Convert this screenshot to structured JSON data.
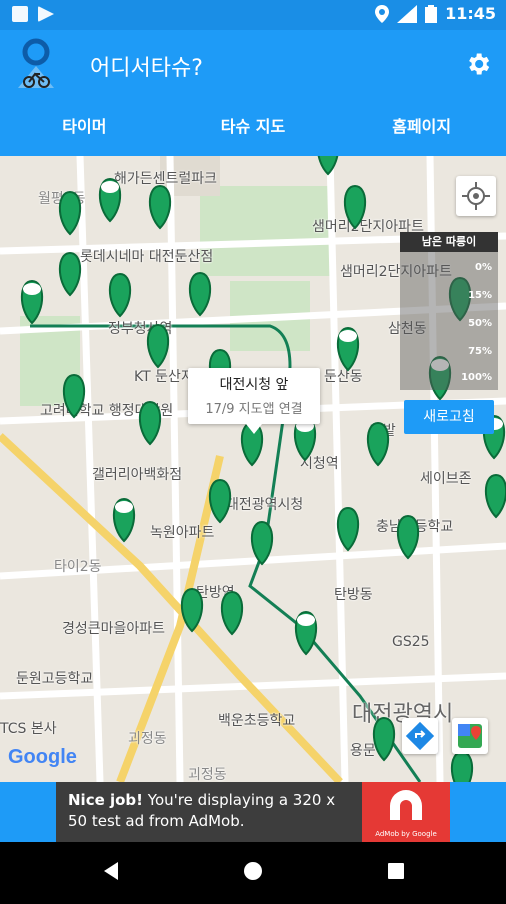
{
  "status_bar": {
    "time": "11:45",
    "network": "LTE"
  },
  "app_bar": {
    "title": "어디서타슈?"
  },
  "tabs": [
    {
      "label": "타이머"
    },
    {
      "label": "타슈 지도"
    },
    {
      "label": "홈페이지"
    }
  ],
  "map": {
    "labels": [
      "해가든센트럴파크",
      "월평2동",
      "롯데시네마 대전둔산점",
      "샘머리2단지아파트",
      "샘머리2단지아파트",
      "정부청사역",
      "KT 둔산지",
      "삼천동",
      "둔산동",
      "고려대학교 행정대학원",
      "갤러리아백화점",
      "시청역",
      "한밭",
      "세이브존",
      "대전광역시청",
      "충남고등학교",
      "녹원아파트",
      "타이2동",
      "탄방역",
      "탄방동",
      "경성큰마을아파트",
      "GS25",
      "둔원고등학교",
      "백운초등학교",
      "괴정동",
      "괴정동",
      "TCS 본사",
      "대전광역시",
      "용문"
    ],
    "legend": {
      "title": "남은 따릉이",
      "levels": [
        "0%",
        "15%",
        "50%",
        "75%",
        "100%"
      ]
    },
    "refresh_label": "새로고침",
    "popup": {
      "title": "대전시청 앞",
      "subtitle": "17/9 지도앱 연결"
    },
    "google_logo": "Google"
  },
  "ad": {
    "headline": "Nice job!",
    "body": "You're displaying a 320 x 50 test ad from AdMob.",
    "brand_caption": "AdMob by Google"
  },
  "colors": {
    "primary": "#1e9bf7",
    "status": "#1a8ee6",
    "marker": "#1aa35c",
    "marker_outline": "#0a6b39"
  }
}
